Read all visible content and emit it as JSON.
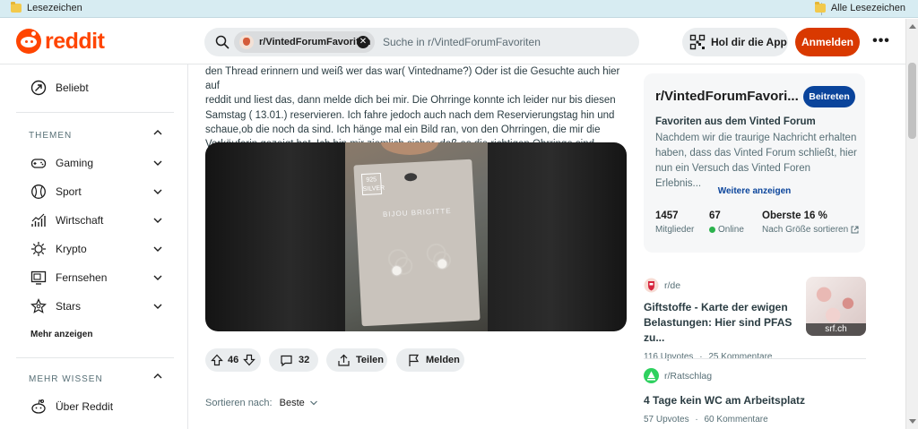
{
  "bookmarks": {
    "left_label": "Lesezeichen",
    "right_label": "Alle Lesezeichen"
  },
  "header": {
    "logo_text": "reddit",
    "search_chip": "r/VintedForumFavoriten",
    "search_placeholder": "Suche in r/VintedForumFavoriten",
    "get_app": "Hol dir die App",
    "login": "Anmelden",
    "more": "•••"
  },
  "sidebar": {
    "popular": "Beliebt",
    "themes_heading": "THEMEN",
    "topics": [
      "Gaming",
      "Sport",
      "Wirtschaft",
      "Krypto",
      "Fernsehen",
      "Stars"
    ],
    "show_more": "Mehr anzeigen",
    "more_heading": "MEHR WISSEN",
    "about": "Über Reddit"
  },
  "post": {
    "text_lines": [
      "den Thread erinnern und weiß wer das war( Vintedname?) Oder ist die Gesuchte auch hier auf",
      "reddit und liest das, dann melde dich bei mir. Die Ohrringe konnte ich leider nur bis diesen",
      "Samstag ( 13.01.) reservieren. Ich fahre jedoch auch nach dem Reservierungstag hin und",
      "schaue,ob die noch da sind. Ich hänge mal ein Bild ran, von den Ohrringen, die mir die",
      "Verkäuferin gezeigt hat. Ich bin mir ziemlich sicher, daß es die richtigen Ohrringe sind."
    ],
    "image_card_silver": "925 SILVER",
    "image_card_brand": "BIJOU BRIGITTE",
    "votes": "46",
    "comments": "32",
    "share": "Teilen",
    "report": "Melden",
    "sort_label": "Sortieren nach:",
    "sort_value": "Beste"
  },
  "community": {
    "name": "r/VintedForumFavori...",
    "join": "Beitreten",
    "subtitle": "Favoriten aus dem Vinted Forum",
    "description": "Nachdem wir die traurige Nachricht erhalten haben, dass das Vinted Forum schließt, hier nun ein Versuch das Vinted Foren Erlebnis...",
    "show_more": "Weitere anzeigen",
    "stats": [
      {
        "value": "1457",
        "label": "Mitglieder"
      },
      {
        "value": "67",
        "label": "Online"
      },
      {
        "value": "Oberste 16 %",
        "label": "Nach Größe sortieren"
      }
    ]
  },
  "related": [
    {
      "subreddit": "r/de",
      "title_line1": "Giftstoffe - Karte der ewigen",
      "title_line2": "Belastungen: Hier sind PFAS zu...",
      "upvotes": "116 Upvotes",
      "comments": "25 Kommentare",
      "thumb_label": "srf.ch"
    },
    {
      "subreddit": "r/Ratschlag",
      "title_line1": "4 Tage kein WC am Arbeitsplatz",
      "upvotes": "57 Upvotes",
      "comments": "60 Kommentare"
    }
  ],
  "colors": {
    "brand": "#ff4500",
    "login": "#d93900",
    "join": "#0a449b",
    "online": "#2bb24c"
  }
}
